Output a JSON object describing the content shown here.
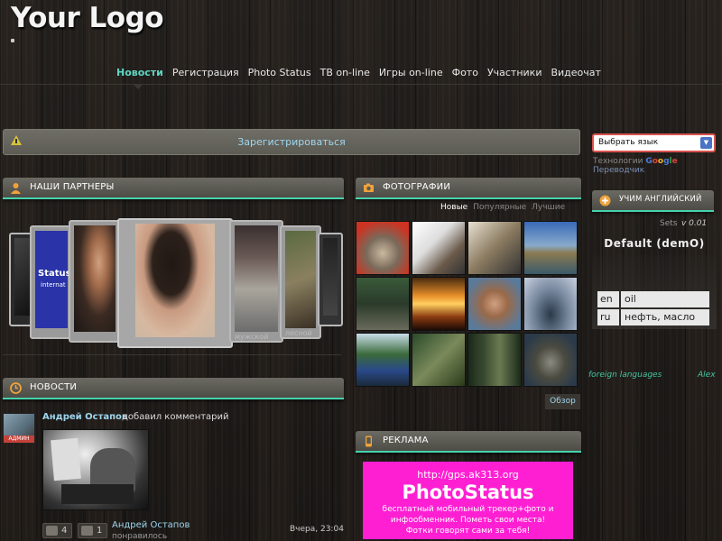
{
  "header": {
    "logo": "Your Logo"
  },
  "nav": {
    "items": [
      {
        "label": "Новости",
        "active": true
      },
      {
        "label": "Регистрация",
        "active": false
      },
      {
        "label": "Photo Status",
        "active": false
      },
      {
        "label": "ТВ on-line",
        "active": false
      },
      {
        "label": "Игры on-line",
        "active": false
      },
      {
        "label": "Фото",
        "active": false
      },
      {
        "label": "Участники",
        "active": false
      },
      {
        "label": "Видеочат",
        "active": false
      }
    ]
  },
  "register_bar": {
    "link": "Зарегистрироваться",
    "icon": "warning-icon"
  },
  "partners": {
    "title": "НАШИ ПАРТНЕРЫ",
    "icon": "user-icon",
    "cards": [
      {
        "caption": "",
        "image": "dark-poster"
      },
      {
        "caption": "",
        "image": "status-banner",
        "text": "Status internat sil"
      },
      {
        "caption": "",
        "image": "man-portrait"
      },
      {
        "caption": "",
        "image": "woman-hair"
      },
      {
        "caption": "мужской",
        "image": "city-building"
      },
      {
        "caption": "лесной",
        "image": "forest-animal"
      },
      {
        "caption": "",
        "image": "dark-sign"
      }
    ]
  },
  "news": {
    "title": "НОВОСТИ",
    "icon": "clock-icon",
    "avatar_badge": "АДМИН",
    "author": "Андрей Остапов",
    "action": "добавил комментарий",
    "comments_count": "4",
    "likes_count": "1",
    "liker": "Андрей Остапов",
    "liked_text": "понравилось",
    "time": "Вчера, 23:04"
  },
  "photos": {
    "title": "ФОТОГРАФИИ",
    "icon": "camera-icon",
    "tabs": [
      {
        "label": "Новые",
        "active": true
      },
      {
        "label": "Популярные",
        "active": false
      },
      {
        "label": "Лучшие",
        "active": false
      }
    ],
    "browse": "Обзор",
    "thumbnails": [
      "cat-sunglasses",
      "cat-window",
      "cats-window",
      "boat-bay",
      "hunter-dog",
      "sunset-lake",
      "man-shirtless",
      "mountain-top",
      "forest-lake",
      "forest-stairs",
      "forest-dark",
      "rocky-shore"
    ]
  },
  "ads": {
    "title": "РЕКЛАМА",
    "icon": "phone-icon",
    "url": "http://gps.ak313.org",
    "headline": "PhotoStatus",
    "line1": "бесплатный мобильный трекер+фото и",
    "line2": "инфообменник. Пометь свои места!",
    "line3": "Фотки говорят сами за тебя!"
  },
  "right": {
    "language_select": "Выбрать язык",
    "translate_prefix": "Технологии",
    "translate_google": "Google",
    "translate_suffix": "Переводчик",
    "english": {
      "title": "УЧИМ АНГЛИЙСКИЙ",
      "icon": "plus-circle-icon",
      "sets_label": "Sets",
      "sets_version": "v 0.01",
      "default_label": "Default (demO)",
      "words": [
        {
          "lang": "en",
          "value": "oil"
        },
        {
          "lang": "ru",
          "value": "нефть, масло"
        }
      ],
      "footer_left": "foreign languages",
      "footer_right": "Alex"
    }
  },
  "colors": {
    "accent": "#46d3ad",
    "active_nav": "#5fd6c1",
    "link": "#9fd6ee",
    "ad_background": "#ff1fd3"
  }
}
